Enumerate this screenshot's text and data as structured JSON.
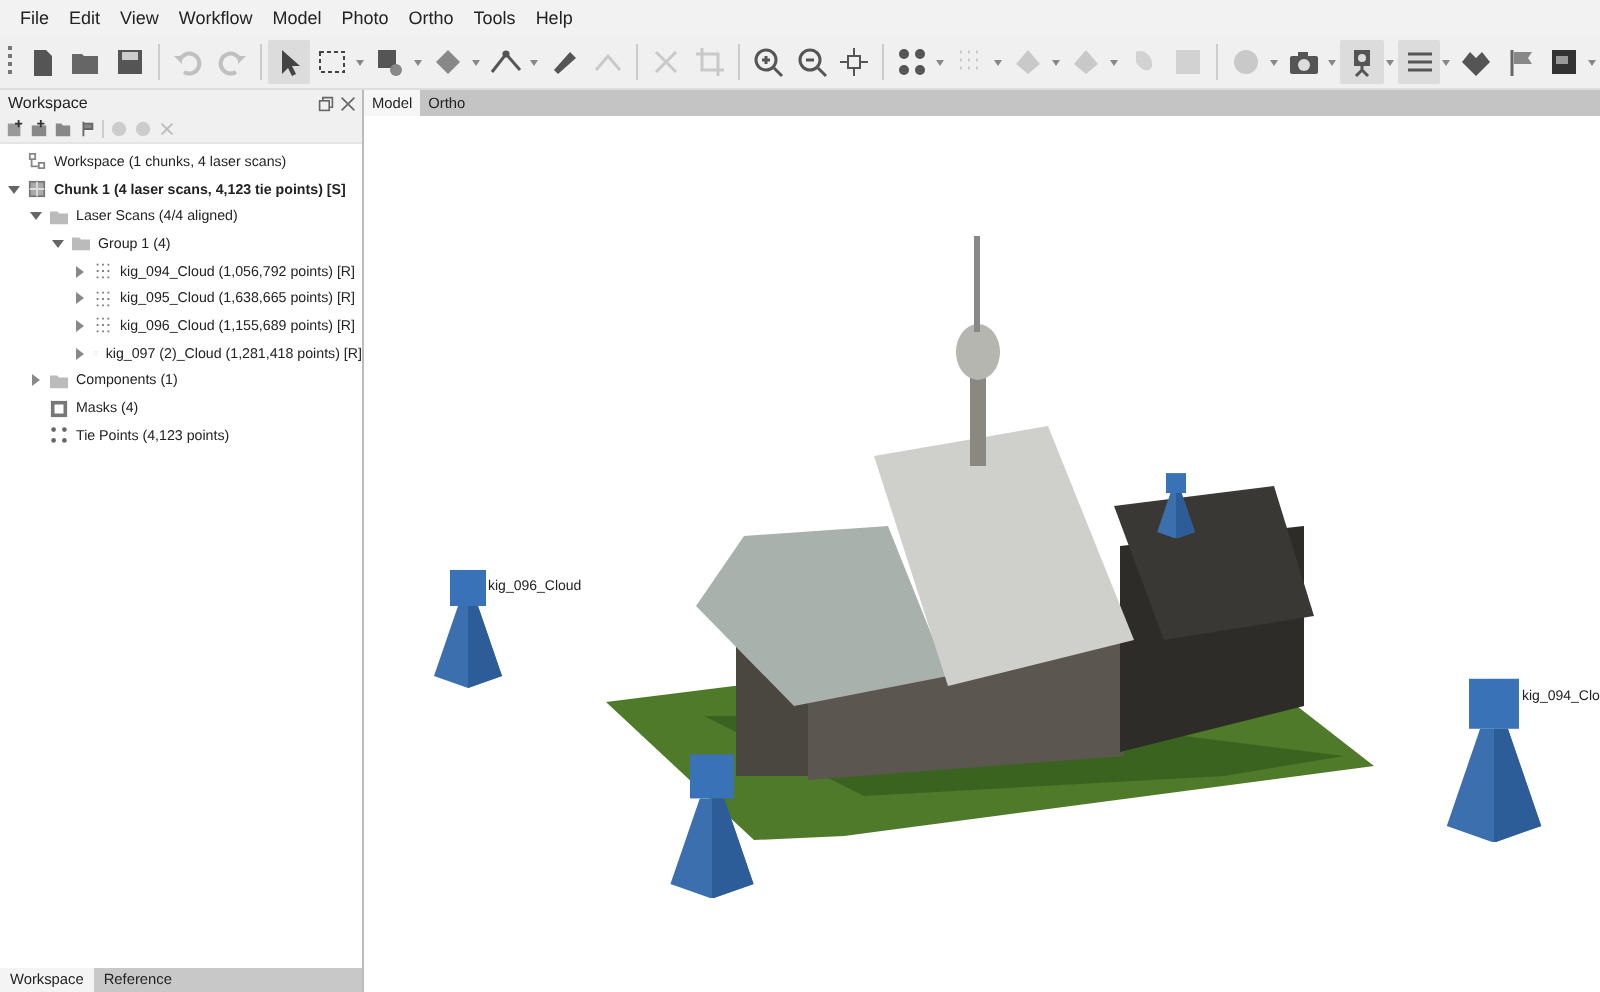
{
  "menu": [
    "File",
    "Edit",
    "View",
    "Workflow",
    "Model",
    "Photo",
    "Ortho",
    "Tools",
    "Help"
  ],
  "toolbar": [
    {
      "kind": "new",
      "disabled": false,
      "selected": false,
      "dropdown": false
    },
    {
      "kind": "open",
      "disabled": false,
      "selected": false,
      "dropdown": false
    },
    {
      "kind": "save",
      "disabled": false,
      "selected": false,
      "dropdown": false
    },
    {
      "kind": "sep"
    },
    {
      "kind": "undo",
      "disabled": true,
      "selected": false,
      "dropdown": false
    },
    {
      "kind": "redo",
      "disabled": true,
      "selected": false,
      "dropdown": false
    },
    {
      "kind": "sep"
    },
    {
      "kind": "pointer",
      "disabled": false,
      "selected": true,
      "dropdown": false
    },
    {
      "kind": "rect",
      "disabled": false,
      "selected": false,
      "dropdown": true
    },
    {
      "kind": "paint",
      "disabled": false,
      "selected": false,
      "dropdown": true
    },
    {
      "kind": "shape",
      "disabled": false,
      "selected": false,
      "dropdown": true
    },
    {
      "kind": "polyline",
      "disabled": false,
      "selected": false,
      "dropdown": true
    },
    {
      "kind": "ruler",
      "disabled": false,
      "selected": false,
      "dropdown": false
    },
    {
      "kind": "caret",
      "disabled": true,
      "selected": false,
      "dropdown": false
    },
    {
      "kind": "sep"
    },
    {
      "kind": "delete",
      "disabled": true,
      "selected": false,
      "dropdown": false
    },
    {
      "kind": "crop",
      "disabled": true,
      "selected": false,
      "dropdown": false
    },
    {
      "kind": "sep"
    },
    {
      "kind": "zoomin",
      "disabled": false,
      "selected": false,
      "dropdown": false
    },
    {
      "kind": "zoomout",
      "disabled": false,
      "selected": false,
      "dropdown": false
    },
    {
      "kind": "move",
      "disabled": false,
      "selected": false,
      "dropdown": false
    },
    {
      "kind": "sep"
    },
    {
      "kind": "points",
      "disabled": false,
      "selected": false,
      "dropdown": true
    },
    {
      "kind": "dense",
      "disabled": true,
      "selected": false,
      "dropdown": true
    },
    {
      "kind": "model",
      "disabled": true,
      "selected": false,
      "dropdown": true
    },
    {
      "kind": "model",
      "disabled": true,
      "selected": false,
      "dropdown": true
    },
    {
      "kind": "tiled",
      "disabled": true,
      "selected": false,
      "dropdown": false
    },
    {
      "kind": "ortho",
      "disabled": true,
      "selected": false,
      "dropdown": false
    },
    {
      "kind": "sep"
    },
    {
      "kind": "globe",
      "disabled": true,
      "selected": false,
      "dropdown": true
    },
    {
      "kind": "camera",
      "disabled": false,
      "selected": false,
      "dropdown": true
    },
    {
      "kind": "scanner",
      "disabled": false,
      "selected": true,
      "dropdown": true
    },
    {
      "kind": "list",
      "disabled": false,
      "selected": true,
      "dropdown": true
    },
    {
      "kind": "heart",
      "disabled": false,
      "selected": false,
      "dropdown": false
    },
    {
      "kind": "flag",
      "disabled": false,
      "selected": false,
      "dropdown": false
    },
    {
      "kind": "image",
      "disabled": false,
      "selected": false,
      "dropdown": true
    }
  ],
  "workspace": {
    "title": "Workspace",
    "tree": [
      {
        "label": "Workspace (1 chunks, 4 laser scans)",
        "kind": "workspace"
      },
      {
        "label": "Chunk 1 (4 laser scans, 4,123 tie points) [S]",
        "kind": "chunk",
        "expanded": true,
        "children": [
          {
            "label": "Laser Scans (4/4 aligned)",
            "kind": "folder",
            "expanded": true,
            "children": [
              {
                "label": "Group 1 (4)",
                "kind": "folder",
                "expanded": true,
                "children": [
                  {
                    "label": "kig_094_Cloud (1,056,792 points) [R]",
                    "kind": "cloud",
                    "expanded": false
                  },
                  {
                    "label": "kig_095_Cloud (1,638,665 points) [R]",
                    "kind": "cloud",
                    "expanded": false
                  },
                  {
                    "label": "kig_096_Cloud (1,155,689 points) [R]",
                    "kind": "cloud",
                    "expanded": false
                  },
                  {
                    "label": "kig_097 (2)_Cloud (1,281,418 points) [R]",
                    "kind": "cloud",
                    "expanded": false
                  }
                ]
              }
            ]
          },
          {
            "label": "Components (1)",
            "kind": "folder",
            "expanded": false
          },
          {
            "label": "Masks (4)",
            "kind": "mask"
          },
          {
            "label": "Tie Points (4,123 points)",
            "kind": "points"
          }
        ]
      }
    ]
  },
  "bottom_tabs": [
    {
      "label": "Workspace",
      "selected": true
    },
    {
      "label": "Reference",
      "selected": false
    }
  ],
  "view_tabs": [
    {
      "label": "Model",
      "selected": true
    },
    {
      "label": "Ortho",
      "selected": false
    }
  ],
  "scanner_labels": [
    "kig_096_Cloud",
    "kig_094_Clo"
  ]
}
